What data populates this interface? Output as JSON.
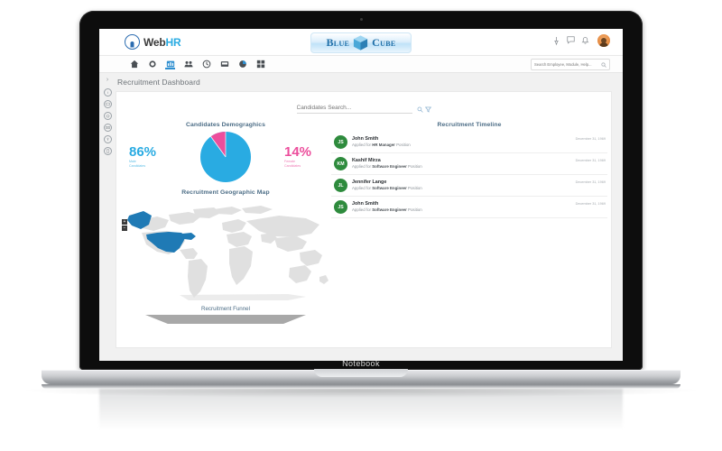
{
  "device": {
    "label": "Notebook"
  },
  "app": {
    "brand": {
      "name_primary": "Web",
      "name_accent": "HR"
    },
    "product_logo": {
      "word1": "Blue",
      "word2": "Cube"
    },
    "top_icons": [
      {
        "name": "pin-icon",
        "glyph": "⚑"
      },
      {
        "name": "chat-icon",
        "glyph": "○"
      },
      {
        "name": "bell-icon",
        "glyph": "○"
      }
    ],
    "avatar": {
      "name": "user-avatar"
    },
    "nav_items": [
      {
        "name": "nav-home",
        "icon": "home-icon",
        "active": false
      },
      {
        "name": "nav-settings",
        "icon": "gear-icon",
        "active": false
      },
      {
        "name": "nav-dashboard",
        "icon": "dashboard-icon",
        "active": true
      },
      {
        "name": "nav-people",
        "icon": "people-icon",
        "active": false
      },
      {
        "name": "nav-time",
        "icon": "clock-icon",
        "active": false
      },
      {
        "name": "nav-reports",
        "icon": "report-icon",
        "active": false
      },
      {
        "name": "nav-analytics",
        "icon": "pie-chart-icon",
        "active": false
      },
      {
        "name": "nav-apps",
        "icon": "grid-icon",
        "active": false
      }
    ],
    "global_search": {
      "placeholder": "Search Employee, Module, Help...",
      "value": ""
    }
  },
  "left_rail": {
    "toggle_glyph": "›",
    "items": [
      {
        "name": "rail-info",
        "glyph": "i"
      },
      {
        "name": "rail-monitor",
        "glyph": "▭"
      },
      {
        "name": "rail-home",
        "glyph": "⌂"
      },
      {
        "name": "rail-mail",
        "glyph": "✉"
      },
      {
        "name": "rail-link",
        "glyph": "⚭"
      },
      {
        "name": "rail-doc",
        "glyph": "▯"
      }
    ]
  },
  "breadcrumb": {
    "label": "Recruitment Dashboard"
  },
  "candidates_search": {
    "placeholder": "Candidates Search...",
    "value": ""
  },
  "demographics": {
    "title": "Candidates Demograghics",
    "male": {
      "value": "86%",
      "label_line1": "Male",
      "label_line2": "Candidates",
      "color": "#29abe2"
    },
    "female": {
      "value": "14%",
      "label_line1": "Female",
      "label_line2": "Candidates",
      "color": "#ec4e9c"
    }
  },
  "geo_map": {
    "title": "Recruitment Geographic Map",
    "zoom_in": "+",
    "zoom_out": "−",
    "highlight_color": "#1f7ab5",
    "base_color": "#e0e0e0",
    "highlighted_regions": [
      "United States",
      "Alaska"
    ]
  },
  "funnel": {
    "title": "Recruitment Funnel",
    "color": "#a8a8a8"
  },
  "timeline": {
    "title": "Recruitment Timeline",
    "applied_prefix": "Applied for",
    "applied_suffix": "Position",
    "items": [
      {
        "initials": "JS",
        "name": "John Smith",
        "position": "HR Manager",
        "date": "December 31, 1969"
      },
      {
        "initials": "KM",
        "name": "Kashif Mirza",
        "position": "Software Engineer",
        "date": "December 31, 1969"
      },
      {
        "initials": "JL",
        "name": "Jennifer Lange",
        "position": "Software Engineer",
        "date": "December 31, 1969"
      },
      {
        "initials": "JS",
        "name": "John Smith",
        "position": "Software Engineer",
        "date": "December 31, 1969"
      }
    ]
  },
  "chart_data": {
    "type": "pie",
    "title": "Candidates Demograghics",
    "categories": [
      "Male Candidates",
      "Female Candidates"
    ],
    "values": [
      86,
      14
    ],
    "colors": [
      "#29abe2",
      "#ec4e9c"
    ],
    "unit": "%",
    "legend": "side-labels"
  }
}
